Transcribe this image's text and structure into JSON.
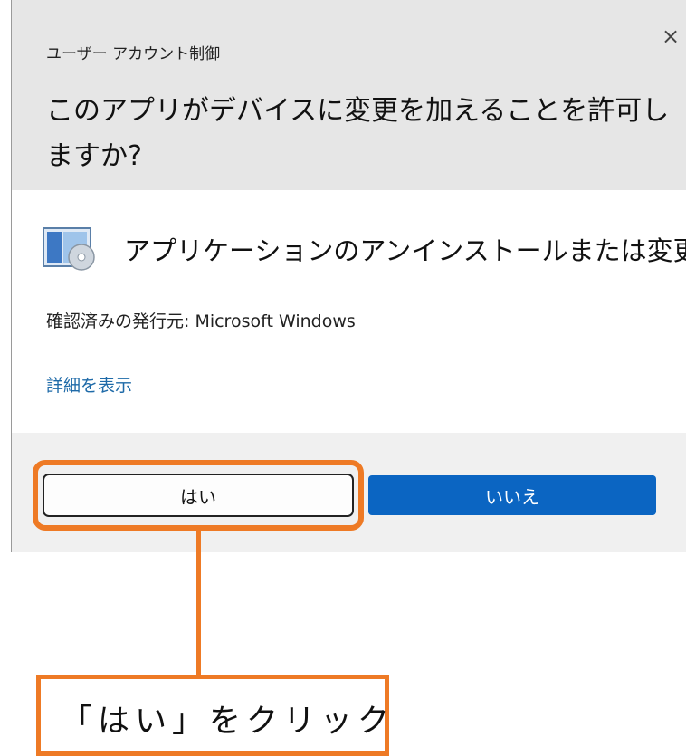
{
  "dialog": {
    "title": "ユーザー アカウント制御",
    "close_label": "×",
    "question": "このアプリがデバイスに変更を加えることを許可しますか?",
    "app_name": "アプリケーションのアンインストールまたは変更",
    "app_icon": "installer-cd-icon",
    "publisher": "確認済みの発行元: Microsoft Windows",
    "details_link": "詳細を表示",
    "yes_label": "はい",
    "no_label": "いいえ"
  },
  "annotation": {
    "callout_text": "「はい」をクリック",
    "accent_color": "#ee7a25"
  },
  "colors": {
    "header_bg": "#e6e6e6",
    "primary_button": "#0b65c2",
    "link": "#1e6aa8"
  }
}
